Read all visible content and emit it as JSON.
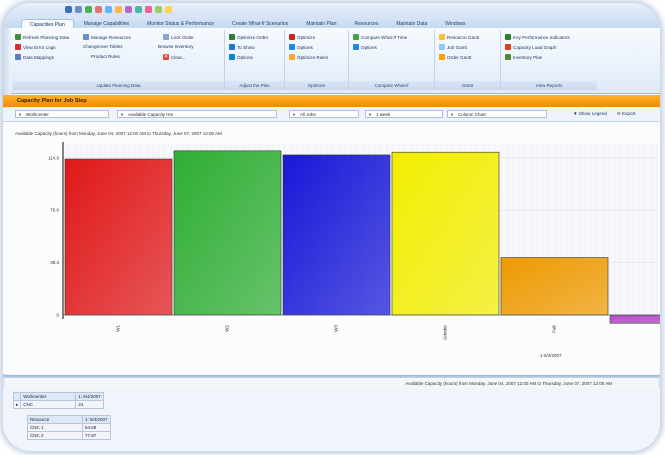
{
  "ribbon_tabs": [
    "Capacities Plan",
    "Manage Capabilities",
    "Monitor Status & Performance",
    "Create What-If Scenarios",
    "Maintain Plan",
    "Resources",
    "Maintain Data",
    "Windows"
  ],
  "ribbon": {
    "group1": {
      "label": "Update Planning Data",
      "items": [
        "Refresh Planning Data",
        "View Error Logs",
        "Data Mappings",
        "Manage Resources",
        "Changeover Tables",
        "Product Rules",
        "Lock Order",
        "Browse Inventory",
        "Clear..."
      ]
    },
    "group2": {
      "label": "Adjust the Plan",
      "items": [
        "Optimize Order",
        "To Show",
        "Options"
      ]
    },
    "group3": {
      "label": "Optimize",
      "items": [
        "Optimize",
        "Options",
        "Optimize Rules"
      ]
    },
    "group4": {
      "label": "Compare What-if",
      "items": [
        "Compare What-If Time",
        "Options"
      ]
    },
    "group5": {
      "label": "Gantt",
      "items": [
        "Resource Gantt",
        "Job Gantt",
        "Order Gantt"
      ]
    },
    "group6": {
      "label": "View Reports",
      "items": [
        "Key Performance Indicators",
        "Capacity Load Graph",
        "Inventory Plan"
      ]
    }
  },
  "panel_title": "Capacity Plan for Job Step",
  "filters": {
    "f1": "Workcenter",
    "f2": "Available Capacity Hrs",
    "f3": "All Jobs",
    "f4": "1 week",
    "f5": "Column Chart",
    "show_legend": "Show Legend",
    "export": "Export"
  },
  "chart_caption_top": "Available Capacity (hours) from Monday, June 04, 2007 12:00 AM to Thursday, June 07, 2007 12:00 AM",
  "chart_caption_bottom": "Available Capacity (hours) from Monday, June 04, 2007 12:00 AM to Thursday, June 07, 2007 12:00 AM",
  "chart_data": {
    "type": "bar",
    "categories": [
      "W1",
      "W2",
      "W3",
      "Grinder",
      "Fab"
    ],
    "values": [
      114,
      120,
      117,
      119,
      42,
      -6
    ],
    "colors": [
      "#e01818",
      "#2fae34",
      "#1818d8",
      "#f2ee00",
      "#ee9a00",
      "#b44cc4"
    ],
    "y_ticks": [
      0,
      38.3,
      76.6,
      114.9
    ],
    "ylim": [
      0,
      125
    ],
    "x_date": "1-6/4/2007",
    "grid": true
  },
  "bottom_grid": {
    "table1": {
      "header": [
        "Workcenter",
        "1: 6/4/2007"
      ],
      "rows": [
        [
          "CNC",
          "24"
        ]
      ]
    },
    "table2": {
      "header": [
        "Resource",
        "1: 6/4/2007"
      ],
      "rows": [
        [
          "CNC 1",
          "54.68"
        ],
        [
          "CNC 2",
          "77.87"
        ]
      ]
    }
  }
}
